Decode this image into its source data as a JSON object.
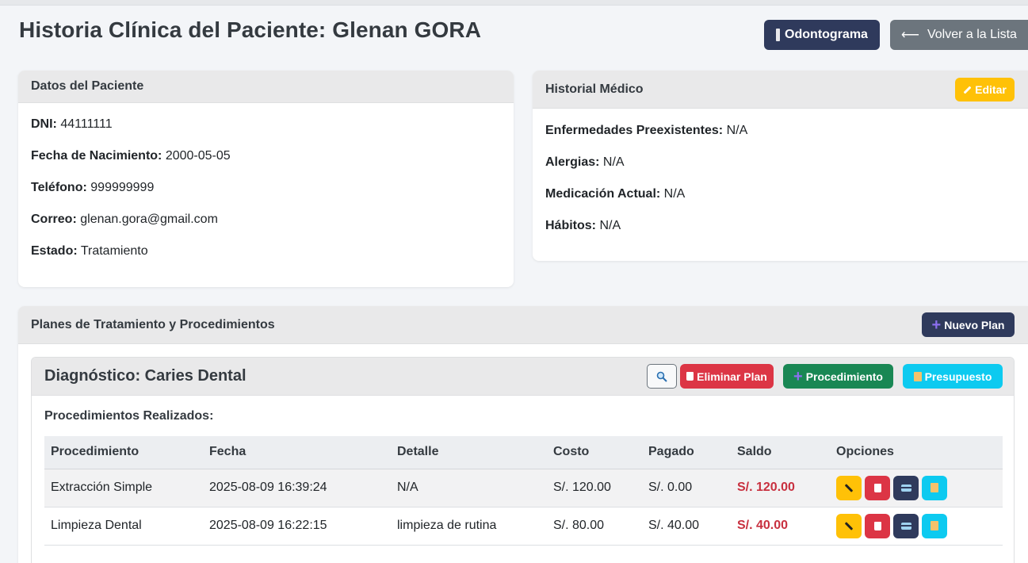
{
  "page": {
    "title": "Historia Clínica del Paciente: Glenan GORA",
    "odontograma_label": "Odontograma",
    "back_label": "Volver a la Lista"
  },
  "datos": {
    "header": "Datos del Paciente",
    "fields": [
      {
        "label": "DNI:",
        "value": "44111111"
      },
      {
        "label": "Fecha de Nacimiento:",
        "value": "2000-05-05"
      },
      {
        "label": "Teléfono:",
        "value": "999999999"
      },
      {
        "label": "Correo:",
        "value": "glenan.gora@gmail.com"
      },
      {
        "label": "Estado:",
        "value": "Tratamiento"
      }
    ]
  },
  "historial": {
    "header": "Historial Médico",
    "edit_label": "Editar",
    "fields": [
      {
        "label": "Enfermedades Preexistentes:",
        "value": "N/A"
      },
      {
        "label": "Alergias:",
        "value": "N/A"
      },
      {
        "label": "Medicación Actual:",
        "value": "N/A"
      },
      {
        "label": "Hábitos:",
        "value": "N/A"
      }
    ]
  },
  "planes": {
    "header": "Planes de Tratamiento y Procedimientos",
    "new_plan_label": "Nuevo Plan",
    "plan": {
      "title": "Diagnóstico: Caries Dental",
      "delete_label": "Eliminar Plan",
      "procedure_label": "Procedimiento",
      "budget_label": "Presupuesto",
      "procedures_title": "Procedimientos Realizados:",
      "columns": [
        "Procedimiento",
        "Fecha",
        "Detalle",
        "Costo",
        "Pagado",
        "Saldo",
        "Opciones"
      ],
      "rows": [
        {
          "procedimiento": "Extracción Simple",
          "fecha": "2025-08-09 16:39:24",
          "detalle": "N/A",
          "costo": "S/. 120.00",
          "pagado": "S/. 0.00",
          "saldo": "S/. 120.00"
        },
        {
          "procedimiento": "Limpieza Dental",
          "fecha": "2025-08-09 16:22:15",
          "detalle": "limpieza de rutina",
          "costo": "S/. 80.00",
          "pagado": "S/. 40.00",
          "saldo": "S/. 40.00"
        }
      ]
    }
  },
  "colors": {
    "primary_dark": "#2f3a5c",
    "warning": "#ffc107",
    "danger": "#dc3545",
    "success": "#198754",
    "info": "#0dcaf0",
    "secondary": "#6c757d",
    "saldo_text": "#c8303f"
  },
  "icons": {
    "odontograma": "tooth-icon",
    "back": "arrow-left-icon",
    "edit": "pencil-icon",
    "new": "plus-icon",
    "search": "magnifier-icon",
    "delete": "trash-icon",
    "payment": "credit-card-icon",
    "budget": "memo-icon"
  }
}
